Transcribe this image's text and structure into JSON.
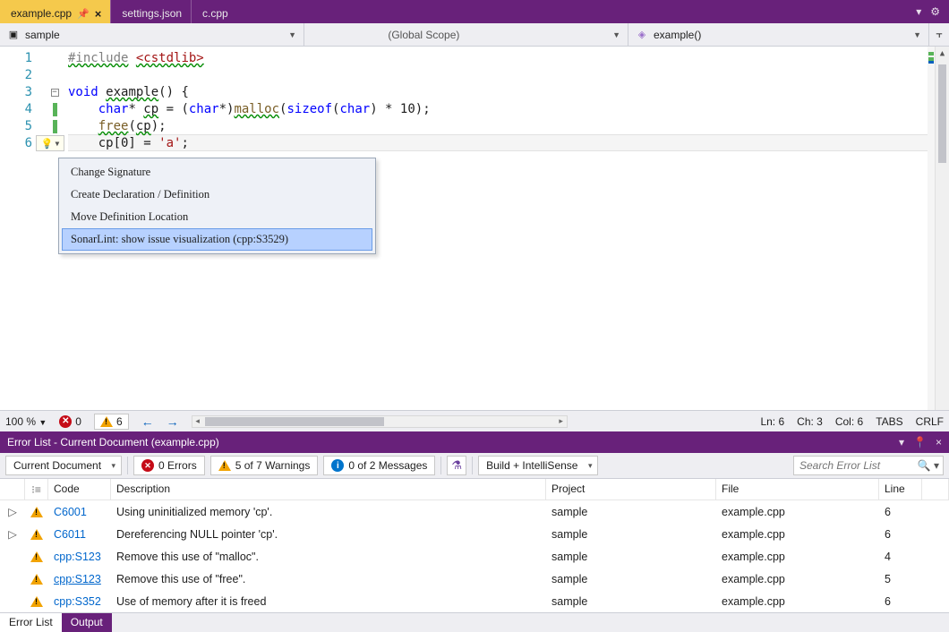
{
  "tabs": [
    {
      "label": "example.cpp",
      "active": true,
      "pinned": true
    },
    {
      "label": "settings.json",
      "active": false
    },
    {
      "label": "c.cpp",
      "active": false
    }
  ],
  "navbar": {
    "scope1": "sample",
    "scope2": "(Global Scope)",
    "scope3": "example()"
  },
  "code": {
    "lines": [
      {
        "n": 1,
        "html": "<span class='pp wavy-g'>#include</span> <span class='inc wavy-g'>&lt;cstdlib&gt;</span>"
      },
      {
        "n": 2,
        "html": ""
      },
      {
        "n": 3,
        "html": "<span class='kw'>void</span> <span class='wavy-g'>example</span>() {",
        "fold": true
      },
      {
        "n": 4,
        "html": "    <span class='kw'>char</span>* <span class='wavy-g'>cp</span> = (<span class='kw'>char</span>*)<span class='fn wavy-g'>malloc</span>(<span class='kw'>sizeof</span>(<span class='kw'>char</span>) * 10);",
        "bar": true
      },
      {
        "n": 5,
        "html": "    <span class='fn wavy-g'>free</span>(<span class='wavy-g'>cp</span>);",
        "bar": true
      },
      {
        "n": 6,
        "html": "    cp[0] = <span class='ch'>'a'</span>;",
        "bar": true,
        "current": true
      }
    ]
  },
  "contextMenu": {
    "items": [
      "Change Signature",
      "Create Declaration / Definition",
      "Move Definition Location",
      "SonarLint: show issue visualization (cpp:S3529)"
    ],
    "selectedIndex": 3
  },
  "editorStatus": {
    "zoom": "100 %",
    "errors": "0",
    "warnings": "6",
    "ln": "Ln: 6",
    "ch": "Ch: 3",
    "col": "Col: 6",
    "tabs": "TABS",
    "eol": "CRLF"
  },
  "errorPanel": {
    "title": "Error List - Current Document (example.cpp)",
    "scope": "Current Document",
    "errSeg": "0 Errors",
    "warnSeg": "5 of 7 Warnings",
    "msgSeg": "0 of 2 Messages",
    "source": "Build + IntelliSense",
    "searchPlaceholder": "Search Error List",
    "columns": {
      "code": "Code",
      "desc": "Description",
      "proj": "Project",
      "file": "File",
      "line": "Line"
    },
    "rows": [
      {
        "exp": "▷",
        "code": "C6001",
        "link": "plain",
        "desc": "Using uninitialized memory 'cp'.",
        "proj": "sample",
        "file": "example.cpp",
        "line": "6"
      },
      {
        "exp": "▷",
        "code": "C6011",
        "link": "plain",
        "desc": "Dereferencing NULL pointer 'cp'.",
        "proj": "sample",
        "file": "example.cpp",
        "line": "6"
      },
      {
        "exp": "",
        "code": "cpp:S123",
        "link": "plain",
        "desc": "Remove this use of \"malloc\".",
        "proj": "sample",
        "file": "example.cpp",
        "line": "4"
      },
      {
        "exp": "",
        "code": "cpp:S123",
        "link": "u",
        "desc": "Remove this use of \"free\".",
        "proj": "sample",
        "file": "example.cpp",
        "line": "5"
      },
      {
        "exp": "",
        "code": "cpp:S352",
        "link": "plain",
        "desc": "Use of memory after it is freed",
        "proj": "sample",
        "file": "example.cpp",
        "line": "6"
      }
    ]
  },
  "bottomTabs": {
    "errorList": "Error List",
    "output": "Output"
  }
}
